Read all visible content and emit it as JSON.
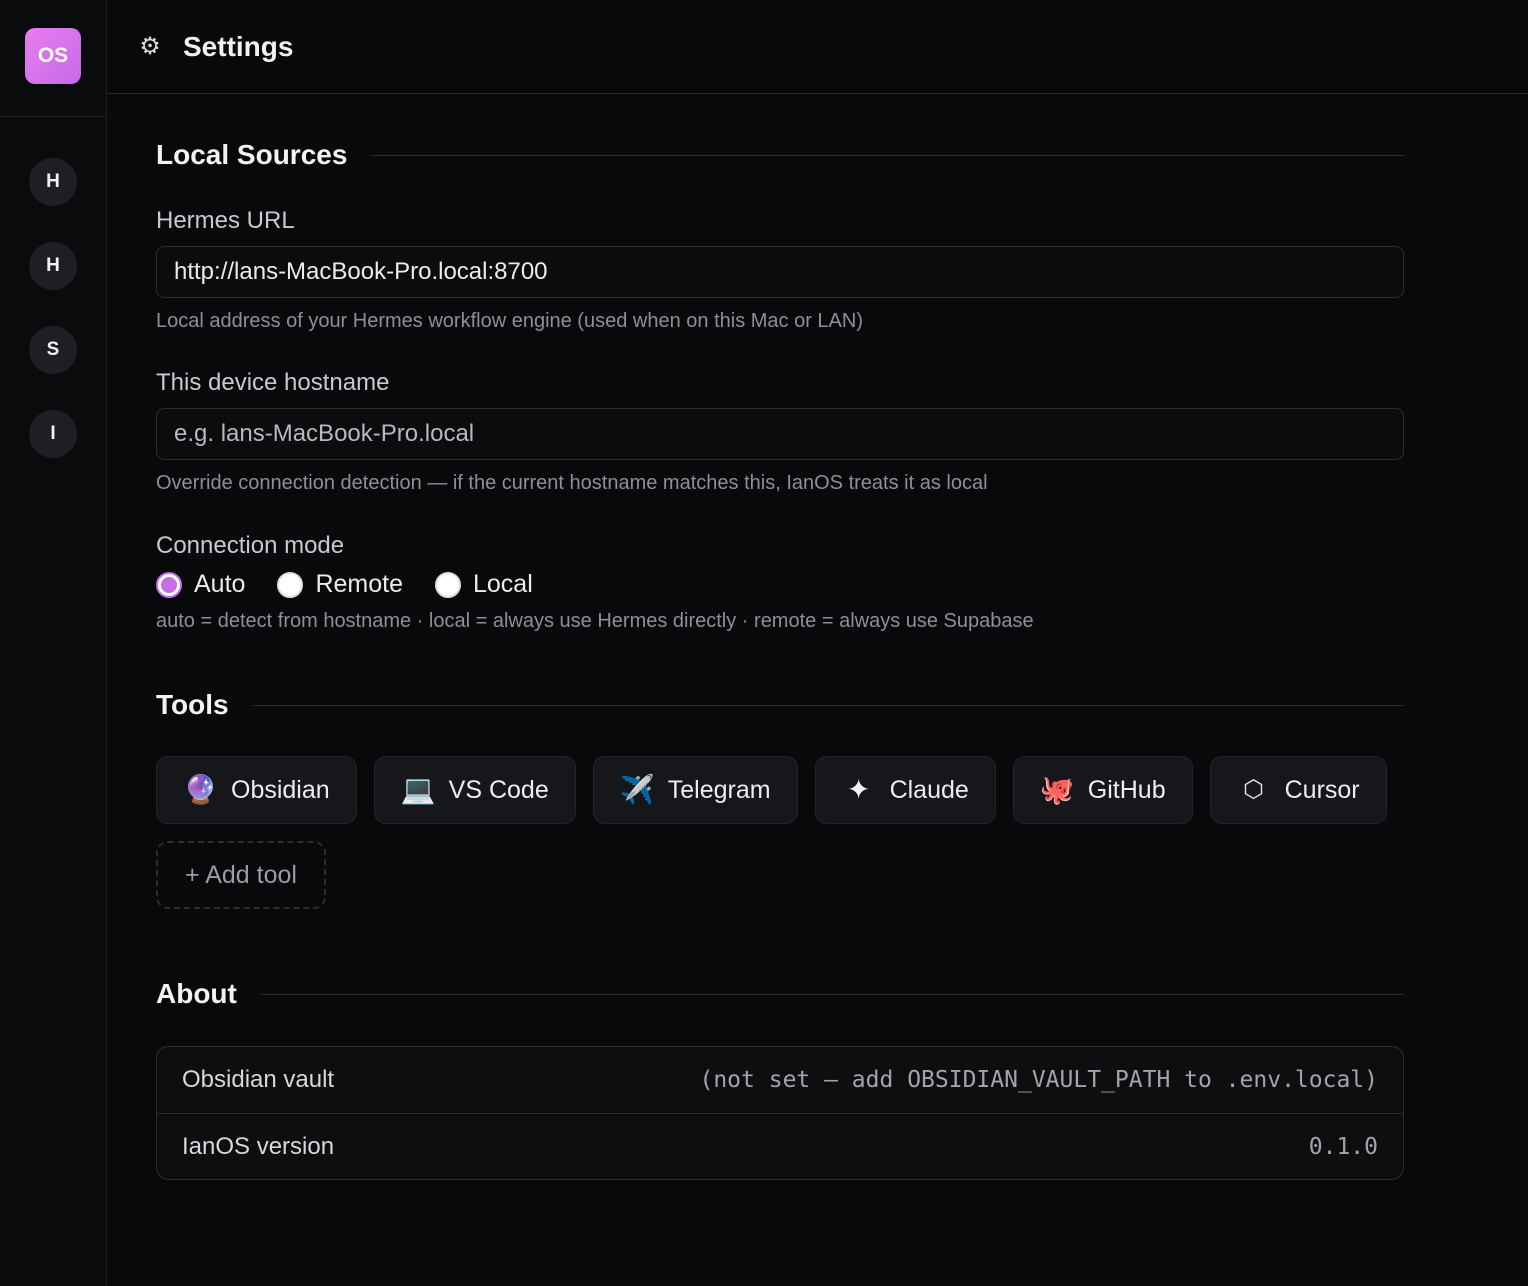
{
  "sidebar": {
    "logo": "OS",
    "items": [
      {
        "label": "H"
      },
      {
        "label": "H"
      },
      {
        "label": "S"
      },
      {
        "label": "I"
      }
    ]
  },
  "header": {
    "icon": "gear-icon",
    "title": "Settings"
  },
  "local_sources": {
    "heading": "Local Sources",
    "hermes_url": {
      "label": "Hermes URL",
      "value": "http://lans-MacBook-Pro.local:8700",
      "hint": "Local address of your Hermes workflow engine (used when on this Mac or LAN)"
    },
    "hostname": {
      "label": "This device hostname",
      "value": "",
      "placeholder": "e.g. lans-MacBook-Pro.local",
      "hint": "Override connection detection — if the current hostname matches this, IanOS treats it as local"
    },
    "connection_mode": {
      "label": "Connection mode",
      "options": [
        "Auto",
        "Remote",
        "Local"
      ],
      "selected": "Auto",
      "hint": "auto = detect from hostname · local = always use Hermes directly · remote = always use Supabase"
    }
  },
  "tools": {
    "heading": "Tools",
    "items": [
      {
        "label": "Obsidian",
        "icon": "crystal-ball-icon",
        "glyph": "🔮"
      },
      {
        "label": "VS Code",
        "icon": "laptop-icon",
        "glyph": "💻"
      },
      {
        "label": "Telegram",
        "icon": "airplane-icon",
        "glyph": "✈️"
      },
      {
        "label": "Claude",
        "icon": "sparkle-icon",
        "glyph": "✦"
      },
      {
        "label": "GitHub",
        "icon": "octopus-icon",
        "glyph": "🐙"
      },
      {
        "label": "Cursor",
        "icon": "hexagon-icon",
        "glyph": "⬡"
      }
    ],
    "add_label": "+ Add tool"
  },
  "about": {
    "heading": "About",
    "rows": [
      {
        "key": "Obsidian vault",
        "value": "(not set — add OBSIDIAN_VAULT_PATH to .env.local)"
      },
      {
        "key": "IanOS version",
        "value": "0.1.0"
      }
    ]
  },
  "colors": {
    "accent": "#c56ee8",
    "background": "#08090b"
  }
}
